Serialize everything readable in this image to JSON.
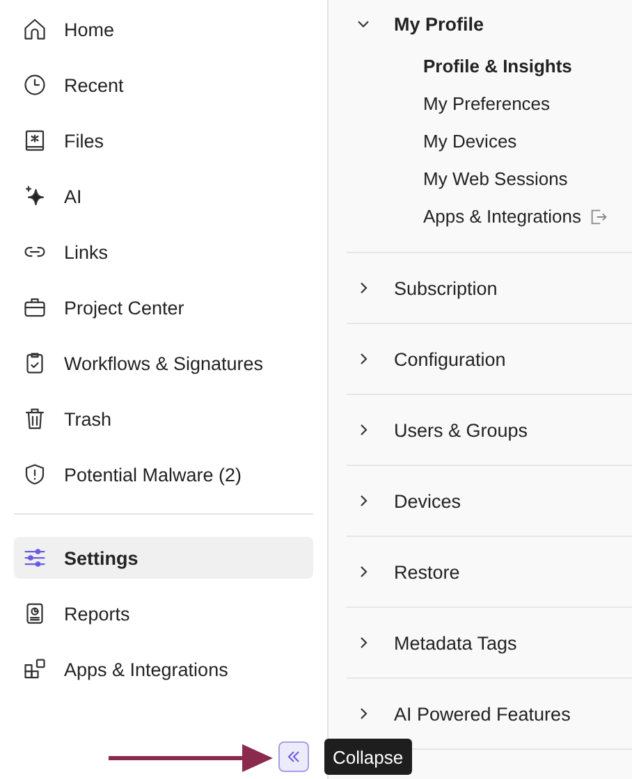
{
  "sidebar": {
    "groups": [
      {
        "items": [
          {
            "label": "Home",
            "selected": false
          },
          {
            "label": "Recent",
            "selected": false
          },
          {
            "label": "Files",
            "selected": false
          },
          {
            "label": "AI",
            "selected": false
          },
          {
            "label": "Links",
            "selected": false
          },
          {
            "label": "Project Center",
            "selected": false
          },
          {
            "label": "Workflows & Signatures",
            "selected": false
          },
          {
            "label": "Trash",
            "selected": false
          },
          {
            "label": "Potential Malware (2)",
            "selected": false
          }
        ]
      },
      {
        "items": [
          {
            "label": "Settings",
            "selected": true
          },
          {
            "label": "Reports",
            "selected": false
          },
          {
            "label": "Apps & Integrations",
            "selected": false
          }
        ]
      }
    ],
    "collapse_tooltip": "Collapse"
  },
  "settings": {
    "sections": [
      {
        "label": "My Profile",
        "expanded": true,
        "children": [
          {
            "label": "Profile & Insights",
            "selected": true,
            "external": false
          },
          {
            "label": "My Preferences",
            "selected": false,
            "external": false
          },
          {
            "label": "My Devices",
            "selected": false,
            "external": false
          },
          {
            "label": "My Web Sessions",
            "selected": false,
            "external": false
          },
          {
            "label": "Apps & Integrations",
            "selected": false,
            "external": true
          }
        ]
      },
      {
        "label": "Subscription",
        "expanded": false
      },
      {
        "label": "Configuration",
        "expanded": false
      },
      {
        "label": "Users & Groups",
        "expanded": false
      },
      {
        "label": "Devices",
        "expanded": false
      },
      {
        "label": "Restore",
        "expanded": false
      },
      {
        "label": "Metadata Tags",
        "expanded": false
      },
      {
        "label": "AI Powered Features",
        "expanded": false
      }
    ]
  }
}
